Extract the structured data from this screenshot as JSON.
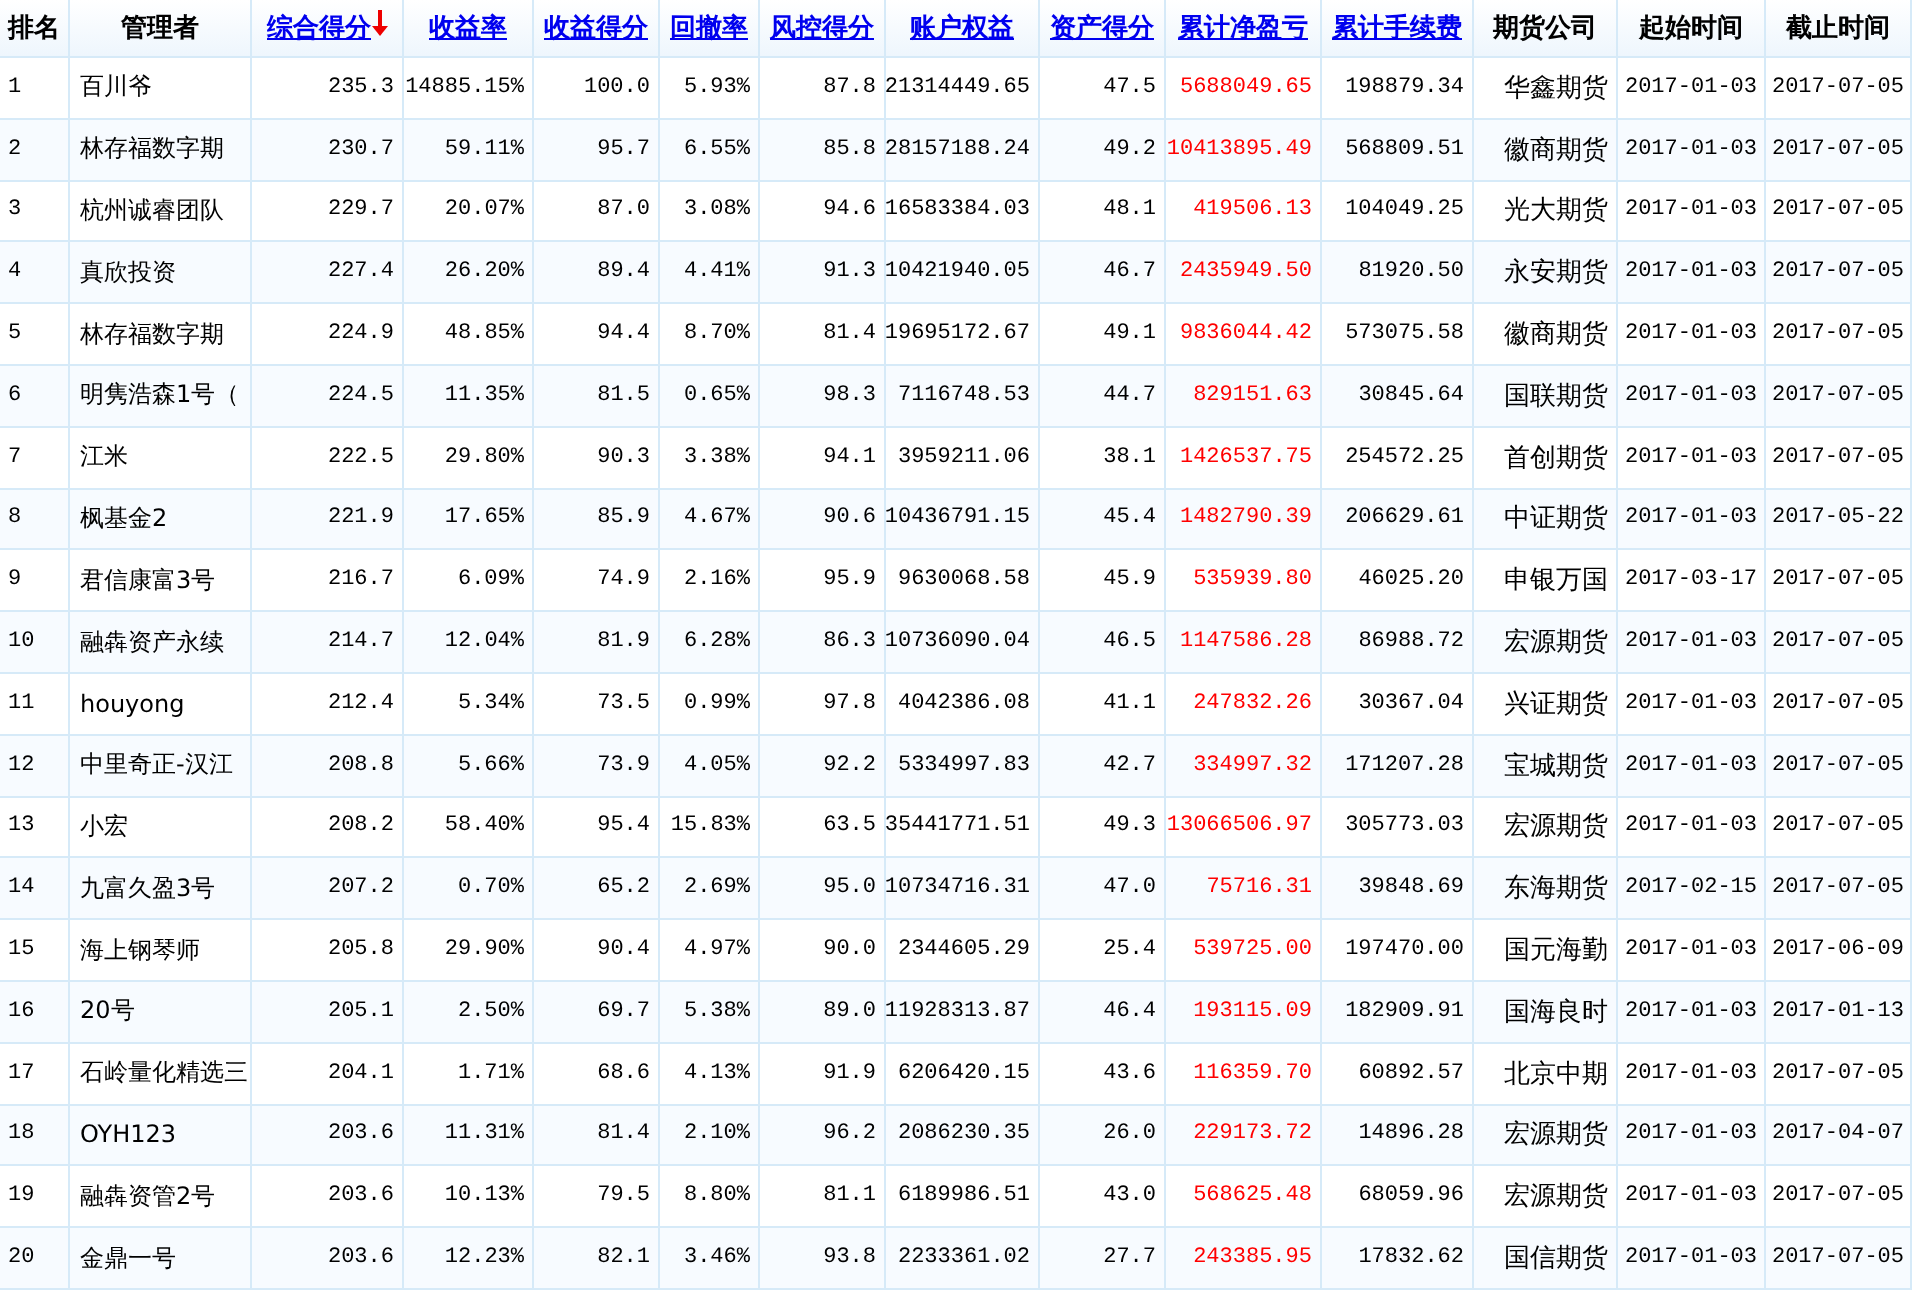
{
  "table": {
    "columns": [
      {
        "label": "排名",
        "kind": "rank",
        "link": false,
        "sorted": false
      },
      {
        "label": "管理者",
        "kind": "text",
        "link": false,
        "sorted": false
      },
      {
        "label": "综合得分",
        "kind": "number",
        "link": true,
        "sorted": true
      },
      {
        "label": "收益率",
        "kind": "number",
        "link": true,
        "sorted": false
      },
      {
        "label": "收益得分",
        "kind": "number",
        "link": true,
        "sorted": false
      },
      {
        "label": "回撤率",
        "kind": "number",
        "link": true,
        "sorted": false
      },
      {
        "label": "风控得分",
        "kind": "number",
        "link": true,
        "sorted": false
      },
      {
        "label": "账户权益",
        "kind": "number",
        "link": true,
        "sorted": false
      },
      {
        "label": "资产得分",
        "kind": "number",
        "link": true,
        "sorted": false
      },
      {
        "label": "累计净盈亏",
        "kind": "money",
        "link": true,
        "sorted": false
      },
      {
        "label": "累计手续费",
        "kind": "number",
        "link": true,
        "sorted": false
      },
      {
        "label": "期货公司",
        "kind": "company",
        "link": false,
        "sorted": false
      },
      {
        "label": "起始时间",
        "kind": "date",
        "link": false,
        "sorted": false
      },
      {
        "label": "截止时间",
        "kind": "date",
        "link": false,
        "sorted": false
      }
    ],
    "rows": [
      {
        "cells": [
          "1",
          "百川爷",
          "235.3",
          "14885.15%",
          "100.0",
          "5.93%",
          "87.8",
          "21314449.65",
          "47.5",
          "5688049.65",
          "198879.34",
          "华鑫期货",
          "2017-01-03",
          "2017-07-05"
        ]
      },
      {
        "cells": [
          "2",
          "林存福数字期",
          "230.7",
          "59.11%",
          "95.7",
          "6.55%",
          "85.8",
          "28157188.24",
          "49.2",
          "10413895.49",
          "568809.51",
          "徽商期货",
          "2017-01-03",
          "2017-07-05"
        ]
      },
      {
        "cells": [
          "3",
          "杭州诚睿团队",
          "229.7",
          "20.07%",
          "87.0",
          "3.08%",
          "94.6",
          "16583384.03",
          "48.1",
          "419506.13",
          "104049.25",
          "光大期货",
          "2017-01-03",
          "2017-07-05"
        ]
      },
      {
        "cells": [
          "4",
          "真欣投资",
          "227.4",
          "26.20%",
          "89.4",
          "4.41%",
          "91.3",
          "10421940.05",
          "46.7",
          "2435949.50",
          "81920.50",
          "永安期货",
          "2017-01-03",
          "2017-07-05"
        ]
      },
      {
        "cells": [
          "5",
          "林存福数字期",
          "224.9",
          "48.85%",
          "94.4",
          "8.70%",
          "81.4",
          "19695172.67",
          "49.1",
          "9836044.42",
          "573075.58",
          "徽商期货",
          "2017-01-03",
          "2017-07-05"
        ]
      },
      {
        "cells": [
          "6",
          "明隽浩森1号（",
          "224.5",
          "11.35%",
          "81.5",
          "0.65%",
          "98.3",
          "7116748.53",
          "44.7",
          "829151.63",
          "30845.64",
          "国联期货",
          "2017-01-03",
          "2017-07-05"
        ]
      },
      {
        "cells": [
          "7",
          "江米",
          "222.5",
          "29.80%",
          "90.3",
          "3.38%",
          "94.1",
          "3959211.06",
          "38.1",
          "1426537.75",
          "254572.25",
          "首创期货",
          "2017-01-03",
          "2017-07-05"
        ]
      },
      {
        "cells": [
          "8",
          "枫基金2",
          "221.9",
          "17.65%",
          "85.9",
          "4.67%",
          "90.6",
          "10436791.15",
          "45.4",
          "1482790.39",
          "206629.61",
          "中证期货",
          "2017-01-03",
          "2017-05-22"
        ]
      },
      {
        "cells": [
          "9",
          "君信康富3号",
          "216.7",
          "6.09%",
          "74.9",
          "2.16%",
          "95.9",
          "9630068.58",
          "45.9",
          "535939.80",
          "46025.20",
          "申银万国",
          "2017-03-17",
          "2017-07-05"
        ]
      },
      {
        "cells": [
          "10",
          "融犇资产永续",
          "214.7",
          "12.04%",
          "81.9",
          "6.28%",
          "86.3",
          "10736090.04",
          "46.5",
          "1147586.28",
          "86988.72",
          "宏源期货",
          "2017-01-03",
          "2017-07-05"
        ]
      },
      {
        "cells": [
          "11",
          "houyong",
          "212.4",
          "5.34%",
          "73.5",
          "0.99%",
          "97.8",
          "4042386.08",
          "41.1",
          "247832.26",
          "30367.04",
          "兴证期货",
          "2017-01-03",
          "2017-07-05"
        ]
      },
      {
        "cells": [
          "12",
          "中里奇正-汉江",
          "208.8",
          "5.66%",
          "73.9",
          "4.05%",
          "92.2",
          "5334997.83",
          "42.7",
          "334997.32",
          "171207.28",
          "宝城期货",
          "2017-01-03",
          "2017-07-05"
        ]
      },
      {
        "cells": [
          "13",
          "小宏",
          "208.2",
          "58.40%",
          "95.4",
          "15.83%",
          "63.5",
          "35441771.51",
          "49.3",
          "13066506.97",
          "305773.03",
          "宏源期货",
          "2017-01-03",
          "2017-07-05"
        ]
      },
      {
        "cells": [
          "14",
          "九富久盈3号",
          "207.2",
          "0.70%",
          "65.2",
          "2.69%",
          "95.0",
          "10734716.31",
          "47.0",
          "75716.31",
          "39848.69",
          "东海期货",
          "2017-02-15",
          "2017-07-05"
        ]
      },
      {
        "cells": [
          "15",
          "海上钢琴师",
          "205.8",
          "29.90%",
          "90.4",
          "4.97%",
          "90.0",
          "2344605.29",
          "25.4",
          "539725.00",
          "197470.00",
          "国元海勤",
          "2017-01-03",
          "2017-06-09"
        ]
      },
      {
        "cells": [
          "16",
          "20号",
          "205.1",
          "2.50%",
          "69.7",
          "5.38%",
          "89.0",
          "11928313.87",
          "46.4",
          "193115.09",
          "182909.91",
          "国海良时",
          "2017-01-03",
          "2017-01-13"
        ]
      },
      {
        "cells": [
          "17",
          "石岭量化精选三",
          "204.1",
          "1.71%",
          "68.6",
          "4.13%",
          "91.9",
          "6206420.15",
          "43.6",
          "116359.70",
          "60892.57",
          "北京中期",
          "2017-01-03",
          "2017-07-05"
        ]
      },
      {
        "cells": [
          "18",
          "OYH123",
          "203.6",
          "11.31%",
          "81.4",
          "2.10%",
          "96.2",
          "2086230.35",
          "26.0",
          "229173.72",
          "14896.28",
          "宏源期货",
          "2017-01-03",
          "2017-04-07"
        ]
      },
      {
        "cells": [
          "19",
          "融犇资管2号",
          "203.6",
          "10.13%",
          "79.5",
          "8.80%",
          "81.1",
          "6189986.51",
          "43.0",
          "568625.48",
          "68059.96",
          "宏源期货",
          "2017-01-03",
          "2017-07-05"
        ]
      },
      {
        "cells": [
          "20",
          "金鼎一号",
          "203.6",
          "12.23%",
          "82.1",
          "3.46%",
          "93.8",
          "2233361.02",
          "27.7",
          "243385.95",
          "17832.62",
          "国信期货",
          "2017-01-03",
          "2017-07-05"
        ]
      }
    ]
  }
}
